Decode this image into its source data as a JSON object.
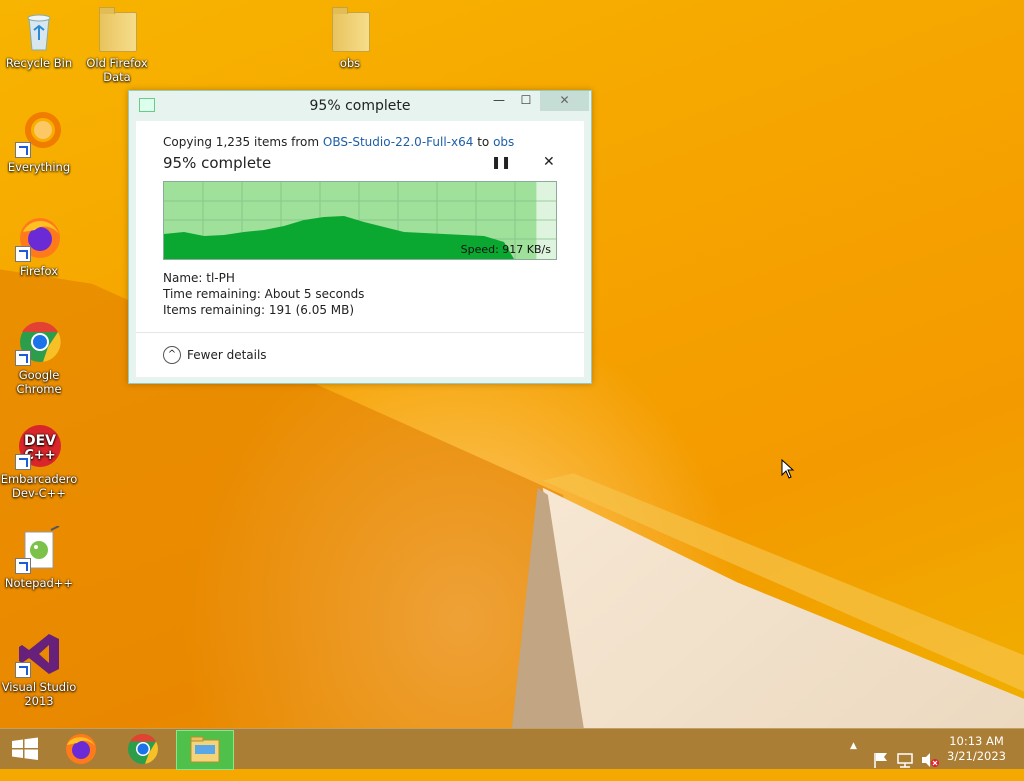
{
  "desktop": {
    "icons": {
      "recycle_bin": "Recycle Bin",
      "old_firefox_data": "Old Firefox Data",
      "obs": "obs",
      "everything": "Everything",
      "firefox": "Firefox",
      "google_chrome": "Google Chrome",
      "embarcadero": "Embarcadero Dev-C++",
      "notepadpp": "Notepad++",
      "visual_studio": "Visual Studio 2013"
    }
  },
  "dialog": {
    "title": "95% complete",
    "window_buttons": {
      "minimize": "—",
      "maximize": "☐",
      "close": "✕"
    },
    "copy_prefix": "Copying 1,235 items from ",
    "source": "OBS-Studio-22.0-Full-x64",
    "copy_mid": " to ",
    "destination": "obs",
    "percent_text": "95% complete",
    "progress_fraction": 0.95,
    "pause_icon": "❚❚",
    "stop_icon": "✕",
    "speed": "Speed: 917 KB/s",
    "name_label": "Name:  ",
    "name_value": "tl-PH",
    "time_label": "Time remaining:  ",
    "time_value": "About 5 seconds",
    "items_label": "Items remaining:  ",
    "items_value": "191 (6.05 MB)",
    "fewer_icon": "^",
    "fewer_details": "Fewer details"
  },
  "taskbar": {
    "clock_time": "10:13 AM",
    "clock_date": "3/21/2023",
    "tray_arrow": "▲"
  },
  "colors": {
    "desktop_bg": "#f5a800",
    "graph_fill": "#0aa731",
    "graph_bg": "#dff4df",
    "link": "#1e5ea8",
    "taskbar_active": "#4fc14a"
  }
}
